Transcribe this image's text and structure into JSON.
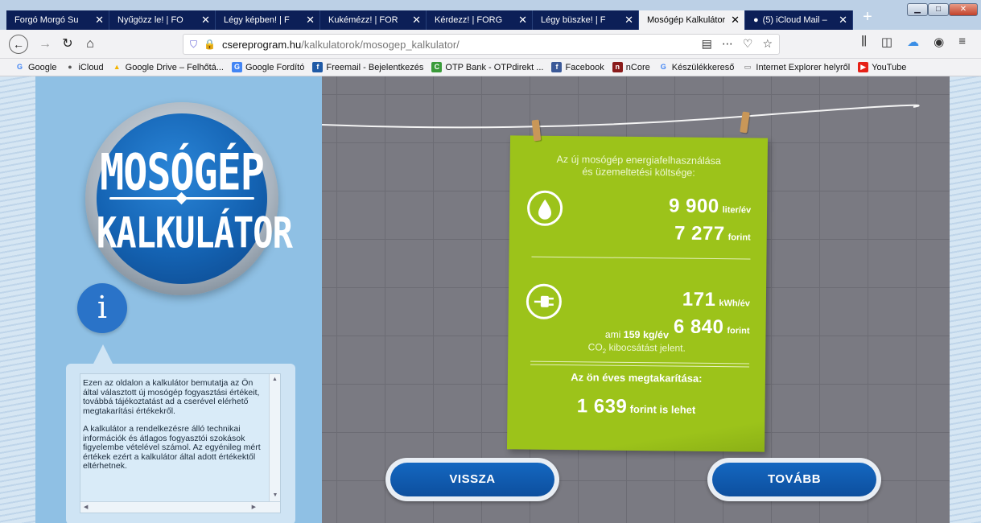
{
  "browser": {
    "tabs": [
      {
        "label": "Forgó Morgó Su",
        "favicon": ""
      },
      {
        "label": "Nyűgözz le! | FO",
        "favicon": ""
      },
      {
        "label": "Légy képben! | F",
        "favicon": ""
      },
      {
        "label": "Kukémézz! | FOR",
        "favicon": ""
      },
      {
        "label": "Kérdezz! | FORG",
        "favicon": ""
      },
      {
        "label": "Légy büszke! | F",
        "favicon": ""
      },
      {
        "label": "Mosógép Kalkulátor",
        "favicon": ""
      },
      {
        "label": "(5) iCloud Mail –",
        "favicon": ""
      }
    ],
    "active_tab_index": 6,
    "url_domain": "csereprogram.hu",
    "url_path": "/kalkulatorok/mosogep_kalkulator/",
    "bookmarks": [
      {
        "label": "Google",
        "icon": "G",
        "color": "#4285f4"
      },
      {
        "label": "iCloud",
        "icon": "",
        "color": "#555555"
      },
      {
        "label": "Google Drive – Felhőtá...",
        "icon": "▲",
        "color": "#f4b400"
      },
      {
        "label": "Google Fordító",
        "icon": "G",
        "color": "#4285f4"
      },
      {
        "label": "Freemail - Bejelentkezés",
        "icon": "f",
        "color": "#1f5aa6"
      },
      {
        "label": "OTP Bank - OTPdirekt ...",
        "icon": "C",
        "color": "#3a9b3a"
      },
      {
        "label": "Facebook",
        "icon": "f",
        "color": "#3b5998"
      },
      {
        "label": "nCore",
        "icon": "n",
        "color": "#8a1b1b"
      },
      {
        "label": "Készülékkereső",
        "icon": "G",
        "color": "#4285f4"
      },
      {
        "label": "Internet Explorer helyről",
        "icon": "▭",
        "color": "#777777"
      },
      {
        "label": "YouTube",
        "icon": "▶",
        "color": "#e62117"
      }
    ]
  },
  "logo": {
    "title": "MOSÓGÉP",
    "subtitle": "KALKULÁTOR"
  },
  "info": {
    "icon": "i",
    "paragraph1": "Ezen az oldalon a kalkulátor bemutatja az Ön által választott új mosógép fogyasztási értékeit, továbbá tájékoztatást ad a cserével elérhető megtakarítási értékekről.",
    "paragraph2": "A kalkulátor a rendelkezésre álló technikai információk és átlagos fogyasztói szokások figyelembe vételével számol. Az egyénileg mért értékek ezért a kalkulátor által adott értékektől eltérhetnek."
  },
  "result": {
    "intro_line1": "Az új mosógép energiafelhasználása",
    "intro_line2": "és üzemeltetési költsége:",
    "water_amount": "9 900",
    "water_unit": "liter/év",
    "water_cost": "7 277",
    "water_cost_unit": "forint",
    "elec_amount": "171",
    "elec_unit": "kWh/év",
    "elec_cost": "6 840",
    "elec_cost_unit": "forint",
    "co2_prefix": "ami",
    "co2_amount": "159 kg/év",
    "co2_gas": "CO",
    "co2_sub": "2",
    "co2_suffix": "kibocsátást jelent.",
    "saving_label": "Az ön éves megtakarítása:",
    "saving_amount": "1 639",
    "saving_suffix": "forint is lehet"
  },
  "buttons": {
    "back": "VISSZA",
    "next": "TOVÁBB"
  },
  "colors": {
    "note_green": "#9cc31a",
    "button_blue": "#1467c0",
    "left_panel": "#8fc0e4",
    "wall_gray": "#7a7a82"
  }
}
